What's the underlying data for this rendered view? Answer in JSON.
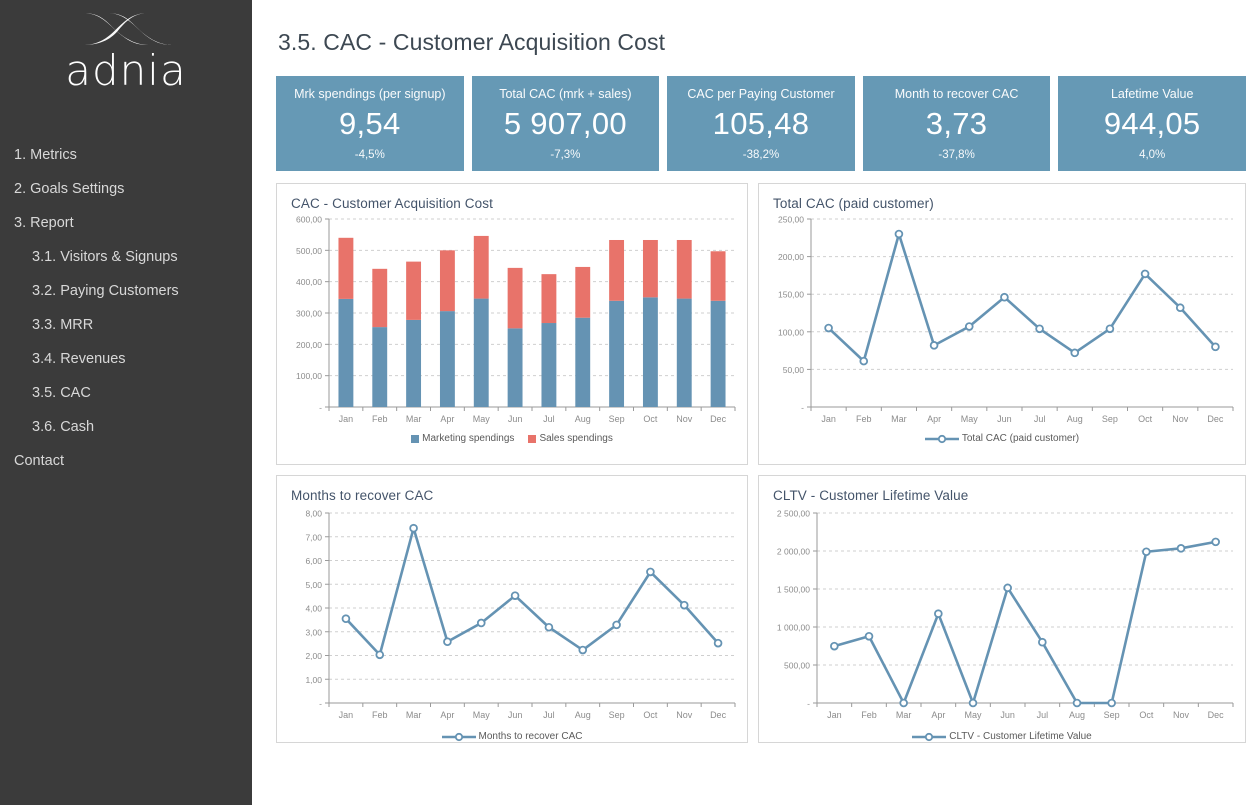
{
  "sidebar": {
    "brand": "adnia",
    "logo_icon": "adnia-double-x-logo",
    "items": [
      {
        "label": "1. Metrics",
        "sub": false
      },
      {
        "label": "2. Goals Settings",
        "sub": false
      },
      {
        "label": "3. Report",
        "sub": false
      },
      {
        "label": "3.1. Visitors & Signups",
        "sub": true
      },
      {
        "label": "3.2. Paying Customers",
        "sub": true
      },
      {
        "label": "3.3. MRR",
        "sub": true
      },
      {
        "label": "3.4. Revenues",
        "sub": true
      },
      {
        "label": "3.5. CAC",
        "sub": true
      },
      {
        "label": "3.6. Cash",
        "sub": true
      },
      {
        "label": "Contact",
        "sub": false
      }
    ]
  },
  "header": {
    "title": "3.5. CAC - Customer Acquisition Cost"
  },
  "colors": {
    "sidebar_bg": "#3b3b3b",
    "card_bg": "#6699b5",
    "series_blue": "#6593b3",
    "series_red": "#e8736a",
    "title_text": "#44546a",
    "axis_text": "#8c8c8c"
  },
  "kpis": [
    {
      "label": "Mrk spendings (per signup)",
      "value": "9,54",
      "delta": "-4,5%"
    },
    {
      "label": "Total CAC (mrk + sales)",
      "value": "5 907,00",
      "delta": "-7,3%"
    },
    {
      "label": "CAC per Paying Customer",
      "value": "105,48",
      "delta": "-38,2%"
    },
    {
      "label": "Month to recover CAC",
      "value": "3,73",
      "delta": "-37,8%"
    },
    {
      "label": "Lafetime Value",
      "value": "944,05",
      "delta": "4,0%"
    }
  ],
  "chart_data": [
    {
      "id": "cac_stacked",
      "type": "bar",
      "stacked": true,
      "title": "CAC - Customer Acquisition Cost",
      "xlabel": "",
      "ylabel": "",
      "ylim": [
        0,
        600
      ],
      "yticks": [
        0,
        100,
        200,
        300,
        400,
        500,
        600
      ],
      "ytick_labels": [
        "-",
        "100,00",
        "200,00",
        "300,00",
        "400,00",
        "500,00",
        "600,00"
      ],
      "grid": true,
      "legend_position": "bottom",
      "categories": [
        "Jan",
        "Feb",
        "Mar",
        "Apr",
        "May",
        "Jun",
        "Jul",
        "Aug",
        "Sep",
        "Oct",
        "Nov",
        "Dec"
      ],
      "series": [
        {
          "name": "Marketing spendings",
          "color": "#6593b3",
          "values": [
            345,
            255,
            278,
            306,
            346,
            251,
            268,
            285,
            339,
            350,
            346,
            339
          ]
        },
        {
          "name": "Sales spendings",
          "color": "#e8736a",
          "values": [
            195,
            186,
            186,
            194,
            200,
            193,
            156,
            162,
            194,
            183,
            187,
            158
          ]
        }
      ],
      "totals": [
        540,
        441,
        464,
        500,
        546,
        444,
        424,
        447,
        533,
        533,
        533,
        497
      ]
    },
    {
      "id": "total_cac_paid",
      "type": "line",
      "title": "Total CAC (paid customer)",
      "xlabel": "",
      "ylabel": "",
      "ylim": [
        0,
        250
      ],
      "yticks": [
        0,
        50,
        100,
        150,
        200,
        250
      ],
      "ytick_labels": [
        "-",
        "50,00",
        "100,00",
        "150,00",
        "200,00",
        "250,00"
      ],
      "grid": true,
      "legend_position": "bottom",
      "categories": [
        "Jan",
        "Feb",
        "Mar",
        "Apr",
        "May",
        "Jun",
        "Jul",
        "Aug",
        "Sep",
        "Oct",
        "Nov",
        "Dec"
      ],
      "series": [
        {
          "name": "Total CAC (paid customer)",
          "color": "#6593b3",
          "values": [
            105,
            61,
            230,
            82,
            107,
            146,
            104,
            72,
            104,
            177,
            132,
            80
          ]
        }
      ]
    },
    {
      "id": "months_recover",
      "type": "line",
      "title": "Months to recover CAC",
      "xlabel": "",
      "ylabel": "",
      "ylim": [
        0,
        8
      ],
      "yticks": [
        0,
        1,
        2,
        3,
        4,
        5,
        6,
        7,
        8
      ],
      "ytick_labels": [
        "-",
        "1,00",
        "2,00",
        "3,00",
        "4,00",
        "5,00",
        "6,00",
        "7,00",
        "8,00"
      ],
      "grid": true,
      "legend_position": "bottom",
      "categories": [
        "Jan",
        "Feb",
        "Mar",
        "Apr",
        "May",
        "Jun",
        "Jul",
        "Aug",
        "Sep",
        "Oct",
        "Nov",
        "Dec"
      ],
      "series": [
        {
          "name": "Months to recover CAC",
          "color": "#6593b3",
          "values": [
            3.55,
            2.03,
            7.36,
            2.58,
            3.37,
            4.52,
            3.19,
            2.23,
            3.29,
            5.52,
            4.12,
            2.52
          ]
        }
      ]
    },
    {
      "id": "cltv",
      "type": "line",
      "title": "CLTV - Customer Lifetime Value",
      "xlabel": "",
      "ylabel": "",
      "ylim": [
        0,
        2500
      ],
      "yticks": [
        0,
        500,
        1000,
        1500,
        2000,
        2500
      ],
      "ytick_labels": [
        "-",
        "500,00",
        "1 000,00",
        "1 500,00",
        "2 000,00",
        "2 500,00"
      ],
      "grid": true,
      "legend_position": "bottom",
      "categories": [
        "Jan",
        "Feb",
        "Mar",
        "Apr",
        "May",
        "Jun",
        "Jul",
        "Aug",
        "Sep",
        "Oct",
        "Nov",
        "Dec"
      ],
      "series": [
        {
          "name": "CLTV - Customer Lifetime Value",
          "color": "#6593b3",
          "values": [
            748,
            878,
            0,
            1175,
            0,
            1515,
            800,
            0,
            0,
            1990,
            2035,
            2120
          ]
        }
      ]
    }
  ]
}
